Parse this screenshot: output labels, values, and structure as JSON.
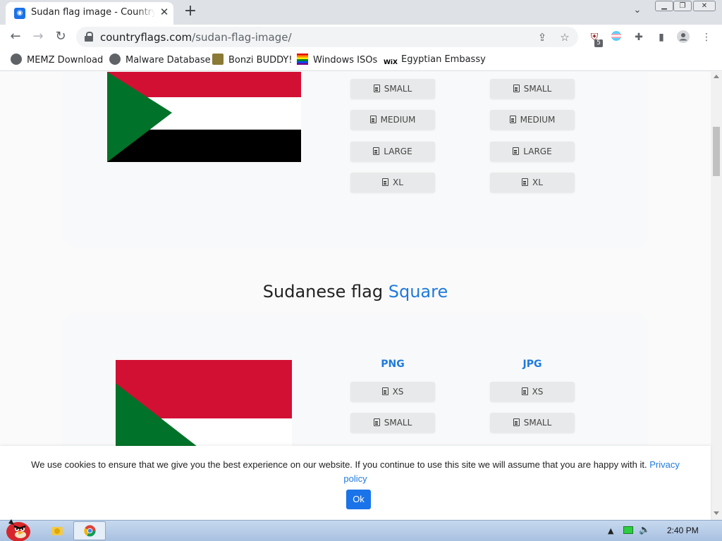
{
  "browser": {
    "tab": {
      "title": "Sudan flag image - Country flags"
    },
    "url": {
      "domain": "countryflags.com",
      "path": "/sudan-flag-image/"
    },
    "extension_badge": "5"
  },
  "bookmarks": [
    {
      "label": "MEMZ Download",
      "icon": "globe-icon"
    },
    {
      "label": "Malware Database",
      "icon": "globe-icon"
    },
    {
      "label": "Bonzi BUDDY!",
      "icon": "bonzi-icon"
    },
    {
      "label": "Windows ISOs",
      "icon": "rainbow-flag-icon"
    },
    {
      "label": "Egyptian Embassy",
      "icon": "wix-icon",
      "icon_text": "WiX"
    }
  ],
  "top_card": {
    "png_buttons": [
      "SMALL",
      "MEDIUM",
      "LARGE",
      "XL"
    ],
    "jpg_buttons": [
      "SMALL",
      "MEDIUM",
      "LARGE",
      "XL"
    ]
  },
  "square_section": {
    "title_main": "Sudanese flag",
    "title_accent": "Square",
    "png_header": "PNG",
    "jpg_header": "JPG",
    "png_buttons": [
      "XS",
      "SMALL"
    ],
    "jpg_buttons": [
      "XS",
      "SMALL"
    ]
  },
  "cookie": {
    "text": "We use cookies to ensure that we give you the best experience on our website. If you continue to use this site we will assume that you are happy with it.",
    "link": "Privacy policy",
    "ok": "Ok"
  },
  "taskbar": {
    "time": "2:40 PM"
  },
  "colors": {
    "flag_red": "#d21034",
    "flag_white": "#ffffff",
    "flag_black": "#000000",
    "flag_green": "#007229",
    "accent_blue": "#1f7adc"
  }
}
